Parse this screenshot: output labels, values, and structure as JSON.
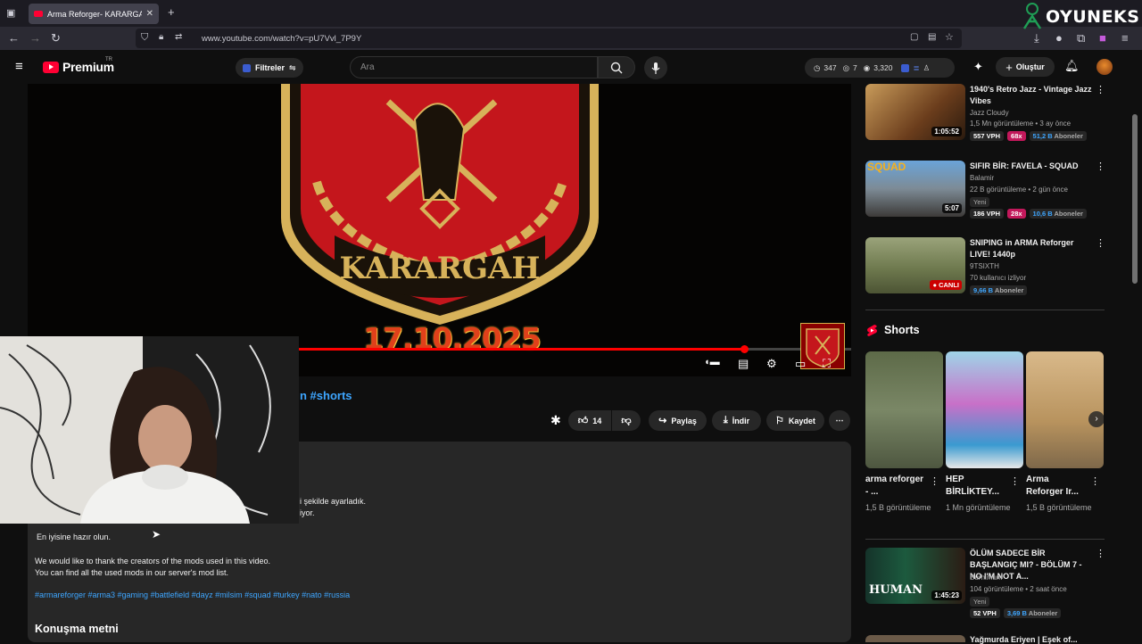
{
  "browser": {
    "tab_title": "Arma Reforger- KARARGAH #ar",
    "url": "www.youtube.com/watch?v=pU7Vvl_7P9Y"
  },
  "watermark": {
    "text": "OYUNEKS"
  },
  "header": {
    "logo": "Premium",
    "logo_region": "TR",
    "filters_label": "Filtreler",
    "search_placeholder": "Ara",
    "stats": {
      "a": "347",
      "b": "7",
      "c": "3,320"
    },
    "create_label": "Oluştur"
  },
  "player": {
    "overlay_date": "17.10.2025",
    "badge_text": "KARARGAH",
    "progress": 0.87
  },
  "video": {
    "title_visible": "n #shorts",
    "like_count": "14",
    "share_label": "Paylaş",
    "download_label": "İndir",
    "save_label": "Kaydet"
  },
  "description": {
    "line_partial_1": "i şekilde ayarladık.",
    "line_partial_2": "iyor.",
    "ready": "En iyisine hazır olun.",
    "thanks_1": "We would like to thank the creators of the mods used in this video.",
    "thanks_2": "You can find all the used mods in our server's mod list.",
    "hashtags": "#armareforger #arma3 #gaming #battlefield #dayz #milsim #squad #turkey #nato #russia",
    "transcript_title": "Konuşma metni"
  },
  "sidebar": {
    "videos": [
      {
        "title": "1940's Retro Jazz - Vintage Jazz Vibes",
        "channel": "Jazz Cloudy",
        "meta": "1,5 Mn görüntüleme • 3 ay önce",
        "duration": "1:05:52",
        "vph": "557 VPH",
        "mult": "68x",
        "subs_val": "51,2 B",
        "subs_label": "Aboneler",
        "new": ""
      },
      {
        "title": "SIFIR BİR: FAVELA - SQUAD",
        "channel": "Balamir",
        "meta": "22 B görüntüleme • 2 gün önce",
        "duration": "5:07",
        "vph": "186 VPH",
        "mult": "28x",
        "subs_val": "10,6 B",
        "subs_label": "Aboneler",
        "new": "Yeni"
      },
      {
        "title": "SNIPING in ARMA Reforger LIVE! 1440p",
        "channel": "9TSIXTH",
        "meta": "70 kullanıcı izliyor",
        "live": "CANLI",
        "subs_val": "9,66 B",
        "subs_label": "Aboneler"
      },
      {
        "title": "ÖLÜM SADECE BİR BAŞLANGIÇ MI? - BÖLÜM 7 - NO I'M NOT A...",
        "channel": "Burhimum",
        "meta": "104 görüntüleme • 2 saat önce",
        "duration": "1:45:23",
        "vph": "52 VPH",
        "subs_val": "3,69 B",
        "subs_label": "Aboneler",
        "new": "Yeni",
        "thumb_text": "HUMAN"
      }
    ],
    "shorts_heading": "Shorts",
    "shorts": [
      {
        "title": "arma reforger - ...",
        "views": "1,5 B görüntüleme"
      },
      {
        "title": "HEP BİRLİKTEY...",
        "views": "1 Mn görüntüleme"
      },
      {
        "title": "Arma Reforger Ir...",
        "views": "1,5 B görüntüleme"
      }
    ],
    "next_partial": "Yağmurda Eriyen | Eşek of..."
  },
  "colors": {
    "accent_red": "#ff0033",
    "link_blue": "#3ea6ff",
    "bg": "#0f0f0f",
    "surface": "#272727"
  }
}
